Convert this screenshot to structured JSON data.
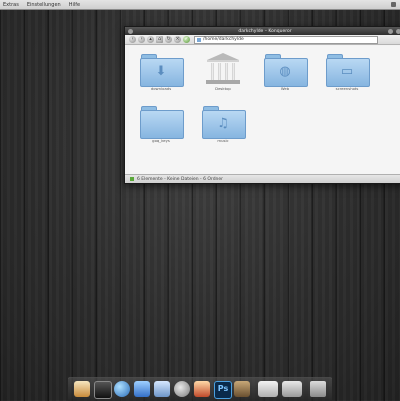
{
  "menubar": {
    "items": [
      "Extras",
      "Einstellungen",
      "Hilfe"
    ]
  },
  "window": {
    "title": "darkchylde – Konqueror",
    "location": "/home/darkchylde",
    "items": [
      {
        "label": "downloads",
        "icon": "download-folder-icon"
      },
      {
        "label": "Desktop",
        "icon": "library-temple-icon"
      },
      {
        "label": "Web",
        "icon": "globe-folder-icon"
      },
      {
        "label": "screenshots",
        "icon": "monitor-folder-icon"
      },
      {
        "label": "goq_keys",
        "icon": "folder-icon"
      },
      {
        "label": "music",
        "icon": "music-folder-icon"
      }
    ],
    "status": "6 Elemente - Keine Dateien - 6 Ordner"
  },
  "dock": {
    "items": [
      "home-icon",
      "terminal-icon",
      "globe-icon",
      "photos-icon",
      "mail-icon",
      "music-player-icon",
      "chess-icon",
      "photoshop-icon",
      "gimp-icon",
      "window-icon",
      "window-icon",
      "trash-icon"
    ],
    "ps_label": "Ps"
  }
}
